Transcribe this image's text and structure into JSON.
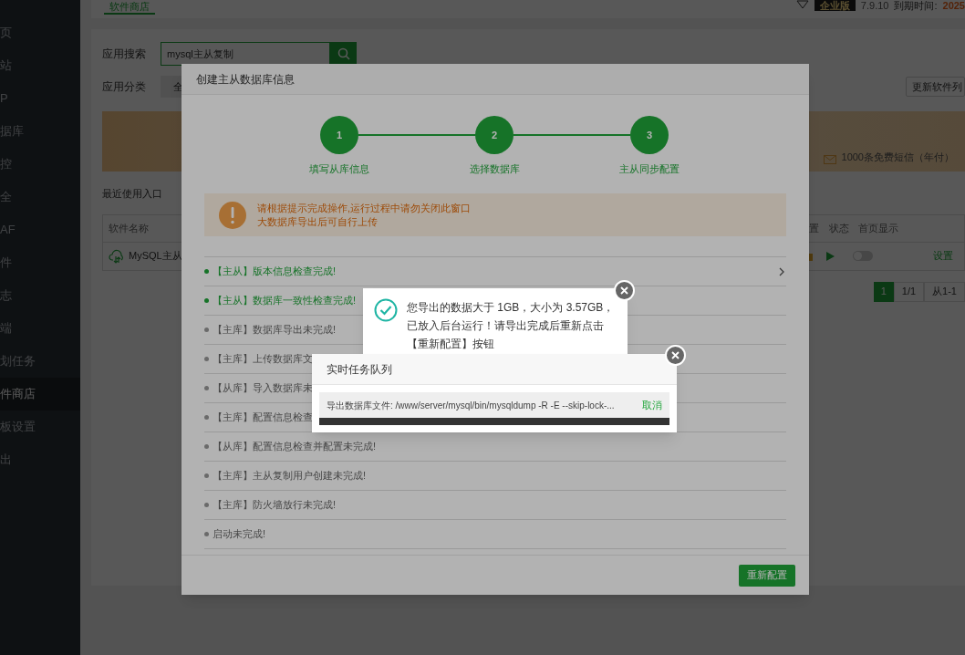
{
  "sidebar": {
    "items": [
      {
        "label": "页",
        "selected": false
      },
      {
        "label": "站",
        "selected": false
      },
      {
        "label": "P",
        "selected": false
      },
      {
        "label": "据库",
        "selected": false
      },
      {
        "label": "控",
        "selected": false
      },
      {
        "label": "全",
        "selected": false
      },
      {
        "label": "AF",
        "selected": false
      },
      {
        "label": "件",
        "selected": false
      },
      {
        "label": "志",
        "selected": false
      },
      {
        "label": "端",
        "selected": false
      },
      {
        "label": "划任务",
        "selected": false
      },
      {
        "label": "件商店",
        "selected": true
      },
      {
        "label": "板设置",
        "selected": false
      },
      {
        "label": "出",
        "selected": false
      }
    ]
  },
  "top_bar": {
    "tab": "软件商店",
    "edition": "企业版",
    "version": "7.9.10",
    "expiry_label": "到期时间:",
    "expiry_value": "2025"
  },
  "search": {
    "label": "应用搜索",
    "value": "mysql主从复制"
  },
  "category": {
    "label": "应用分类",
    "first": "全",
    "update_button": "更新软件列"
  },
  "banner": {
    "sms": "1000条免费短信（年付）"
  },
  "recent": "最近使用入口",
  "table": {
    "columns": [
      "软件名称",
      "置",
      "状态",
      "首页显示"
    ],
    "row": {
      "name": "MySQL主从",
      "on": false,
      "action": "设置"
    }
  },
  "pagination": {
    "pages": [
      {
        "label": "1",
        "selected": true
      }
    ],
    "total": "1/1",
    "range": "从1-1"
  },
  "modal": {
    "title": "创建主从数据库信息",
    "steps": [
      {
        "number": "1",
        "label": "填写从库信息",
        "done": true
      },
      {
        "number": "2",
        "label": "选择数据库",
        "done": true
      },
      {
        "number": "3",
        "label": "主从同步配置",
        "done": true
      }
    ],
    "warning": [
      "请根据提示完成操作,运行过程中请勿关闭此窗口",
      "大数据库导出后可自行上传"
    ],
    "checks": [
      {
        "text": "【主从】版本信息检查完成!",
        "done": true,
        "expandable": true
      },
      {
        "text": "【主从】数据库一致性检查完成!",
        "done": true,
        "expandable": false
      },
      {
        "text": "【主库】数据库导出未完成!",
        "done": false,
        "expandable": false
      },
      {
        "text": "【主库】上传数据库文",
        "done": false,
        "expandable": false
      },
      {
        "text": "【从库】导入数据库未",
        "done": false,
        "expandable": false
      },
      {
        "text": "【主库】配置信息检查",
        "done": false,
        "expandable": false
      },
      {
        "text": "【从库】配置信息检查并配置未完成!",
        "done": false,
        "expandable": false
      },
      {
        "text": "【主库】主从复制用户创建未完成!",
        "done": false,
        "expandable": false
      },
      {
        "text": "【主库】防火墙放行未完成!",
        "done": false,
        "expandable": false
      },
      {
        "text": "启动未完成!",
        "done": false,
        "expandable": false
      }
    ],
    "button": "重新配置"
  },
  "message": {
    "text": "您导出的数据大于 1GB，大小为 3.57GB，已放入后台运行！请导出完成后重新点击【重新配置】按钮"
  },
  "task_queue": {
    "title": "实时任务队列",
    "task": "导出数据库文件: /www/server/mysql/bin/mysqldump -R -E --skip-lock-...",
    "cancel": "取消",
    "level": 1
  }
}
